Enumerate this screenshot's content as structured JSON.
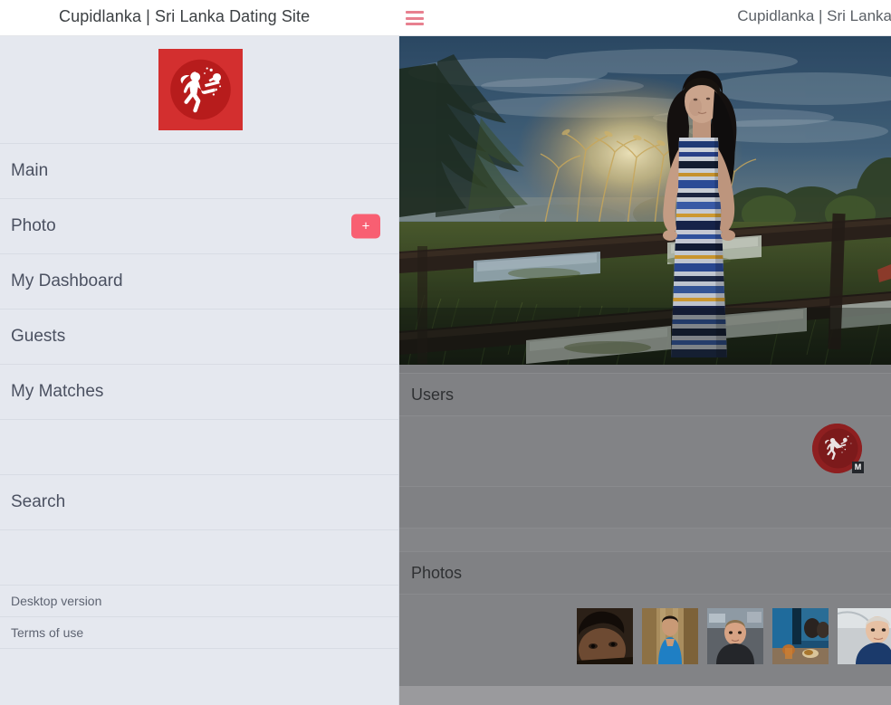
{
  "topbar": {
    "title": "Cupidlanka | Sri Lanka Dating Site",
    "right_title": "Cupidlanka | Sri Lanka",
    "menu_icon": "hamburger-icon"
  },
  "sidebar": {
    "logo_alt": "cupid-logo",
    "items": [
      {
        "label": "Main",
        "size": "big",
        "action": null
      },
      {
        "label": "Photo",
        "size": "big",
        "action": "+"
      },
      {
        "label": "My Dashboard",
        "size": "big",
        "action": null
      },
      {
        "label": "Guests",
        "size": "big",
        "action": null
      },
      {
        "label": "My Matches",
        "size": "big",
        "action": null
      },
      {
        "label": "",
        "size": "blank",
        "action": null
      },
      {
        "label": "Search",
        "size": "big",
        "action": null
      },
      {
        "label": "",
        "size": "blank",
        "action": null
      }
    ],
    "footer_links": [
      {
        "label": "Desktop version"
      },
      {
        "label": "Terms of use"
      }
    ],
    "add_photo_label": "+"
  },
  "main": {
    "hero_alt": "woman-leaning-on-fence-at-sunset",
    "sections": [
      {
        "title": "Users"
      },
      {
        "title": "Photos"
      }
    ],
    "users": {
      "avatar_alt": "cupid-avatar",
      "avatar_badge": "M"
    },
    "photos": {
      "thumbnails": [
        {
          "alt": "portrait-dark-haired-man"
        },
        {
          "alt": "portrait-woman-blue-top"
        },
        {
          "alt": "portrait-blonde-man"
        },
        {
          "alt": "photo-restaurant-table"
        },
        {
          "alt": "portrait-woman-navy-top"
        }
      ]
    }
  },
  "colors": {
    "accent": "#f85f72",
    "logo_red": "#d32f2f",
    "sidebar_bg": "#e5e8ef",
    "overlay_grey": "#808184",
    "text_dark": "#4b5161"
  }
}
